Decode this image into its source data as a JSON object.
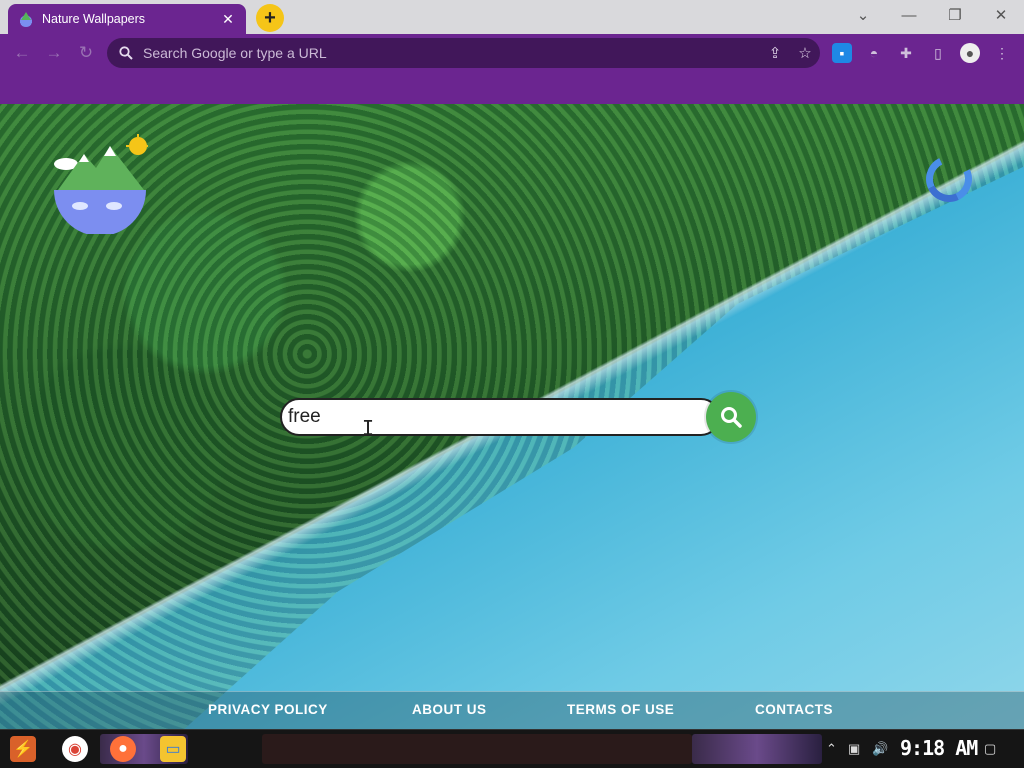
{
  "browser": {
    "tab_title": "Nature Wallpapers",
    "tab_close": "✕",
    "new_tab": "+",
    "window_controls": {
      "dropdown": "⌄",
      "minimize": "—",
      "restore": "❐",
      "close": "✕"
    },
    "omnibox_placeholder": "Search Google or type a URL"
  },
  "page": {
    "search_value": "free",
    "footer_links": [
      "PRIVACY POLICY",
      "ABOUT US",
      "TERMS OF USE",
      "CONTACTS"
    ]
  },
  "taskbar": {
    "clock": "9:18 AM"
  },
  "colors": {
    "browser_accent": "#6b2590",
    "search_button": "#4caf50",
    "new_tab": "#f5c518"
  }
}
